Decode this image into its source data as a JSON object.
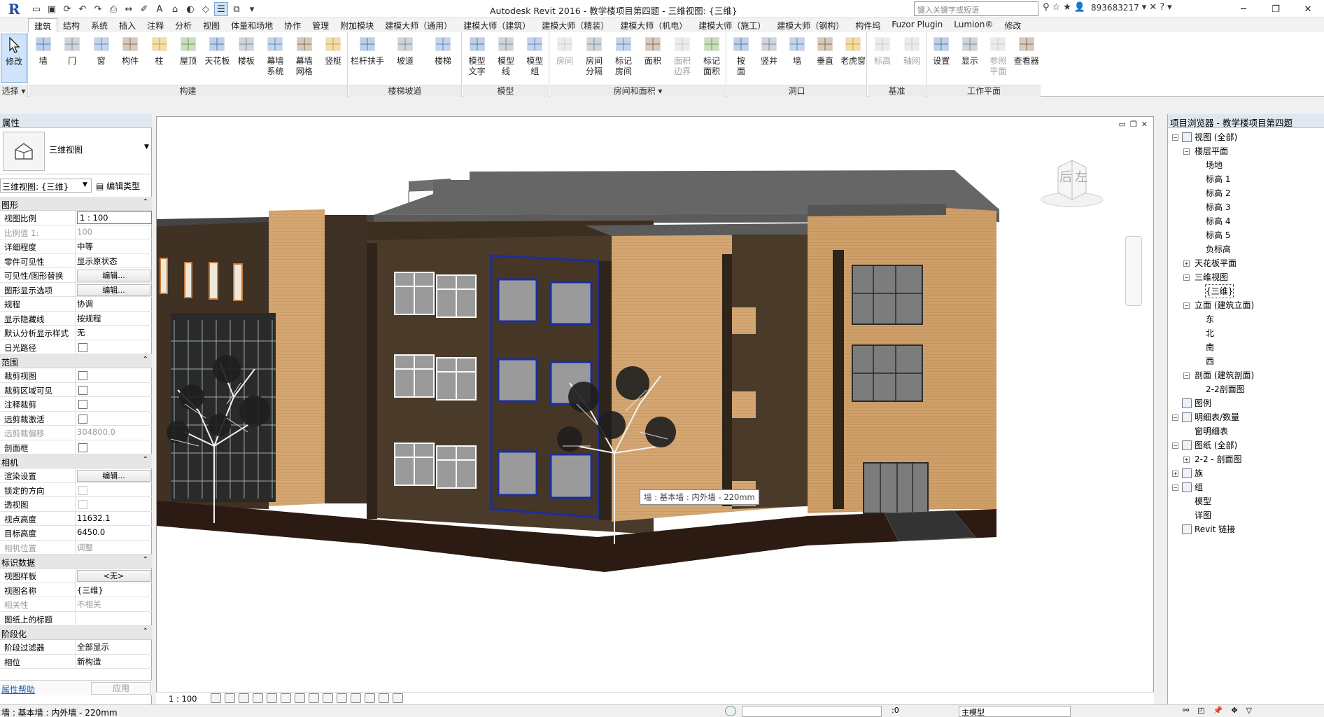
{
  "app": {
    "title": "Autodesk Revit 2016 -   教学楼项目第四题 - 三维视图: {三维}",
    "search_placeholder": "键入关键字或短语",
    "user": "893683217",
    "logo": "R"
  },
  "tabs": [
    "建筑",
    "结构",
    "系统",
    "插入",
    "注释",
    "分析",
    "视图",
    "体量和场地",
    "协作",
    "管理",
    "附加模块",
    "建模大师（通用）",
    "建模大师（建筑）",
    "建模大师（精装）",
    "建模大师（机电）",
    "建模大师（施工）",
    "建模大师（钢构）",
    "构件坞",
    "Fuzor Plugin",
    "Lumion®",
    "修改"
  ],
  "ribbon": {
    "select": {
      "modify": "修改",
      "label": "选择 ▾"
    },
    "build": {
      "label": "构建",
      "buttons": [
        "墙",
        "门",
        "窗",
        "构件",
        "柱",
        "屋顶",
        "天花板",
        "楼板",
        "幕墙\n系统",
        "幕墙\n网格",
        "竖梃"
      ]
    },
    "circulation": {
      "label": "楼梯坡道",
      "buttons": [
        "栏杆扶手",
        "坡道",
        "楼梯"
      ]
    },
    "model": {
      "label": "模型",
      "buttons": [
        "模型\n文字",
        "模型\n线",
        "模型\n组"
      ]
    },
    "room": {
      "label": "房间和面积 ▾",
      "buttons": [
        "房间",
        "房间\n分隔",
        "标记\n房间",
        "面积",
        "面积\n边界",
        "标记\n面积"
      ]
    },
    "opening": {
      "label": "洞口",
      "buttons": [
        "按\n面",
        "竖井",
        "墙",
        "垂直",
        "老虎窗"
      ]
    },
    "datum": {
      "label": "基准",
      "buttons": [
        "标高",
        "轴网"
      ]
    },
    "workplane": {
      "label": "工作平面",
      "buttons": [
        "设置",
        "显示",
        "参照\n平面",
        "查看器"
      ]
    }
  },
  "properties": {
    "title": "属性",
    "type_name": "三维视图",
    "selector": "三维视图: {三维}",
    "edit_type": "编辑类型",
    "sections": [
      {
        "name": "图形",
        "rows": [
          {
            "k": "视图比例",
            "v": "1 : 100",
            "t": "box"
          },
          {
            "k": "比例值 1:",
            "v": "100",
            "t": "dim"
          },
          {
            "k": "详细程度",
            "v": "中等"
          },
          {
            "k": "零件可见性",
            "v": "显示原状态"
          },
          {
            "k": "可见性/图形替换",
            "v": "编辑...",
            "t": "btn"
          },
          {
            "k": "图形显示选项",
            "v": "编辑...",
            "t": "btn"
          },
          {
            "k": "规程",
            "v": "协调"
          },
          {
            "k": "显示隐藏线",
            "v": "按规程"
          },
          {
            "k": "默认分析显示样式",
            "v": "无"
          },
          {
            "k": "日光路径",
            "v": "",
            "t": "cb"
          }
        ]
      },
      {
        "name": "范围",
        "rows": [
          {
            "k": "裁剪视图",
            "v": "",
            "t": "cb"
          },
          {
            "k": "裁剪区域可见",
            "v": "",
            "t": "cb"
          },
          {
            "k": "注释裁剪",
            "v": "",
            "t": "cb"
          },
          {
            "k": "远剪裁激活",
            "v": "",
            "t": "cb"
          },
          {
            "k": "远剪裁偏移",
            "v": "304800.0",
            "t": "dim"
          },
          {
            "k": "剖面框",
            "v": "",
            "t": "cb"
          }
        ]
      },
      {
        "name": "相机",
        "rows": [
          {
            "k": "渲染设置",
            "v": "编辑...",
            "t": "btn"
          },
          {
            "k": "锁定的方向",
            "v": "",
            "t": "cbdim"
          },
          {
            "k": "透视图",
            "v": "",
            "t": "cbdim"
          },
          {
            "k": "视点高度",
            "v": "11632.1"
          },
          {
            "k": "目标高度",
            "v": "6450.0"
          },
          {
            "k": "相机位置",
            "v": "调整",
            "t": "dim"
          }
        ]
      },
      {
        "name": "标识数据",
        "rows": [
          {
            "k": "视图样板",
            "v": "<无>",
            "t": "btn"
          },
          {
            "k": "视图名称",
            "v": "{三维}"
          },
          {
            "k": "相关性",
            "v": "不相关",
            "t": "dim"
          },
          {
            "k": "图纸上的标题",
            "v": ""
          }
        ]
      },
      {
        "name": "阶段化",
        "rows": [
          {
            "k": "阶段过滤器",
            "v": "全部显示"
          },
          {
            "k": "相位",
            "v": "新构造"
          }
        ]
      }
    ],
    "help": "属性帮助",
    "apply": "应用"
  },
  "viewport": {
    "tooltip": "墙 : 基本墙 : 内外墙 - 220mm",
    "scale": "1 : 100",
    "viewcube": {
      "back": "后",
      "left": "左"
    }
  },
  "browser": {
    "title": "项目浏览器 - 教学楼项目第四题",
    "nodes": [
      {
        "t": "视图 (全部)",
        "lvl": 0,
        "tg": "−",
        "icon": true
      },
      {
        "t": "楼层平面",
        "lvl": 1,
        "tg": "−"
      },
      {
        "t": "场地",
        "lvl": 2
      },
      {
        "t": "标高 1",
        "lvl": 2
      },
      {
        "t": "标高 2",
        "lvl": 2
      },
      {
        "t": "标高 3",
        "lvl": 2
      },
      {
        "t": "标高 4",
        "lvl": 2
      },
      {
        "t": "标高 5",
        "lvl": 2
      },
      {
        "t": "负标高",
        "lvl": 2
      },
      {
        "t": "天花板平面",
        "lvl": 1,
        "tg": "+"
      },
      {
        "t": "三维视图",
        "lvl": 1,
        "tg": "−"
      },
      {
        "t": "{三维}",
        "lvl": 2,
        "sel": true
      },
      {
        "t": "立面 (建筑立面)",
        "lvl": 1,
        "tg": "−"
      },
      {
        "t": "东",
        "lvl": 2
      },
      {
        "t": "北",
        "lvl": 2
      },
      {
        "t": "南",
        "lvl": 2
      },
      {
        "t": "西",
        "lvl": 2
      },
      {
        "t": "剖面 (建筑剖面)",
        "lvl": 1,
        "tg": "−"
      },
      {
        "t": "2-2剖面图",
        "lvl": 2
      },
      {
        "t": "图例",
        "lvl": 0,
        "icon": true
      },
      {
        "t": "明细表/数量",
        "lvl": 0,
        "tg": "−",
        "icon": true
      },
      {
        "t": "窗明细表",
        "lvl": 1
      },
      {
        "t": "图纸 (全部)",
        "lvl": 0,
        "tg": "−",
        "icon": true
      },
      {
        "t": "2-2 - 剖面图",
        "lvl": 1,
        "tg": "+"
      },
      {
        "t": "族",
        "lvl": 0,
        "tg": "+",
        "icon": true
      },
      {
        "t": "组",
        "lvl": 0,
        "tg": "−",
        "icon": true
      },
      {
        "t": "模型",
        "lvl": 1
      },
      {
        "t": "详图",
        "lvl": 1
      },
      {
        "t": "Revit 链接",
        "lvl": 0,
        "icon": true
      }
    ]
  },
  "status": {
    "message": "墙 : 基本墙 : 内外墙 - 220mm",
    "model_label": "主模型",
    "zero": ":0"
  }
}
